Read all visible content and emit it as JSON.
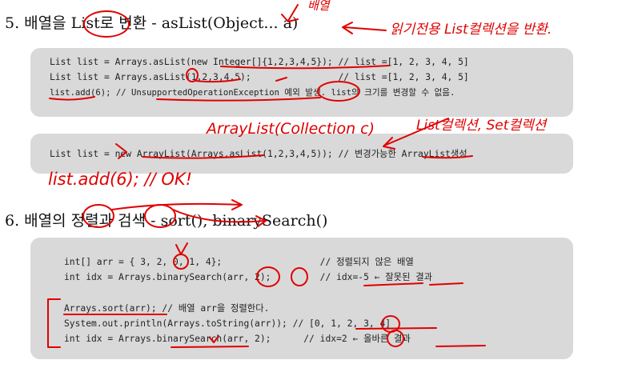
{
  "section5": {
    "title": "5. 배열을 List로 변환 - asList(Object... a)",
    "box1": [
      "List list = Arrays.asList(new Integer[]{1,2,3,4,5}); // list =[1, 2, 3, 4, 5]",
      "List list = Arrays.asList(1,2,3,4,5);                // list =[1, 2, 3, 4, 5]",
      "list.add(6); // UnsupportedOperationException 예외 발생. list의 크기를 변경할 수 없음."
    ],
    "box2": [
      "List list = new ArrayList(Arrays.asList(1,2,3,4,5)); // 변경가능한 ArrayList생성"
    ]
  },
  "section6": {
    "title": "6. 배열의 정렬과 검색 - sort(), binarySearch()",
    "box3": [
      "int[] arr = { 3, 2, 0, 1, 4};                  // 정렬되지 않은 배열",
      "int idx = Arrays.binarySearch(arr, 2);         // idx=-5 ← 잘못된 결과",
      "",
      "Arrays.sort(arr); // 배열 arr을 정렬한다.",
      "System.out.println(Arrays.toString(arr)); // [0, 1, 2, 3, 4]",
      "int idx = Arrays.binarySearch(arr, 2);      // idx=2 ← 올바른 결과"
    ]
  },
  "handwriting": {
    "array_note": "배열",
    "readonly_note": "읽기전용 List컬렉션을 반환.",
    "arraylist_note": "ArrayList(Collection c)",
    "list_set_note": "List컬렉션, Set컬렉션",
    "ok_note": "list.add(6); // OK!"
  },
  "colors": {
    "ink": "#e00000",
    "box": "#d9d9d9"
  }
}
